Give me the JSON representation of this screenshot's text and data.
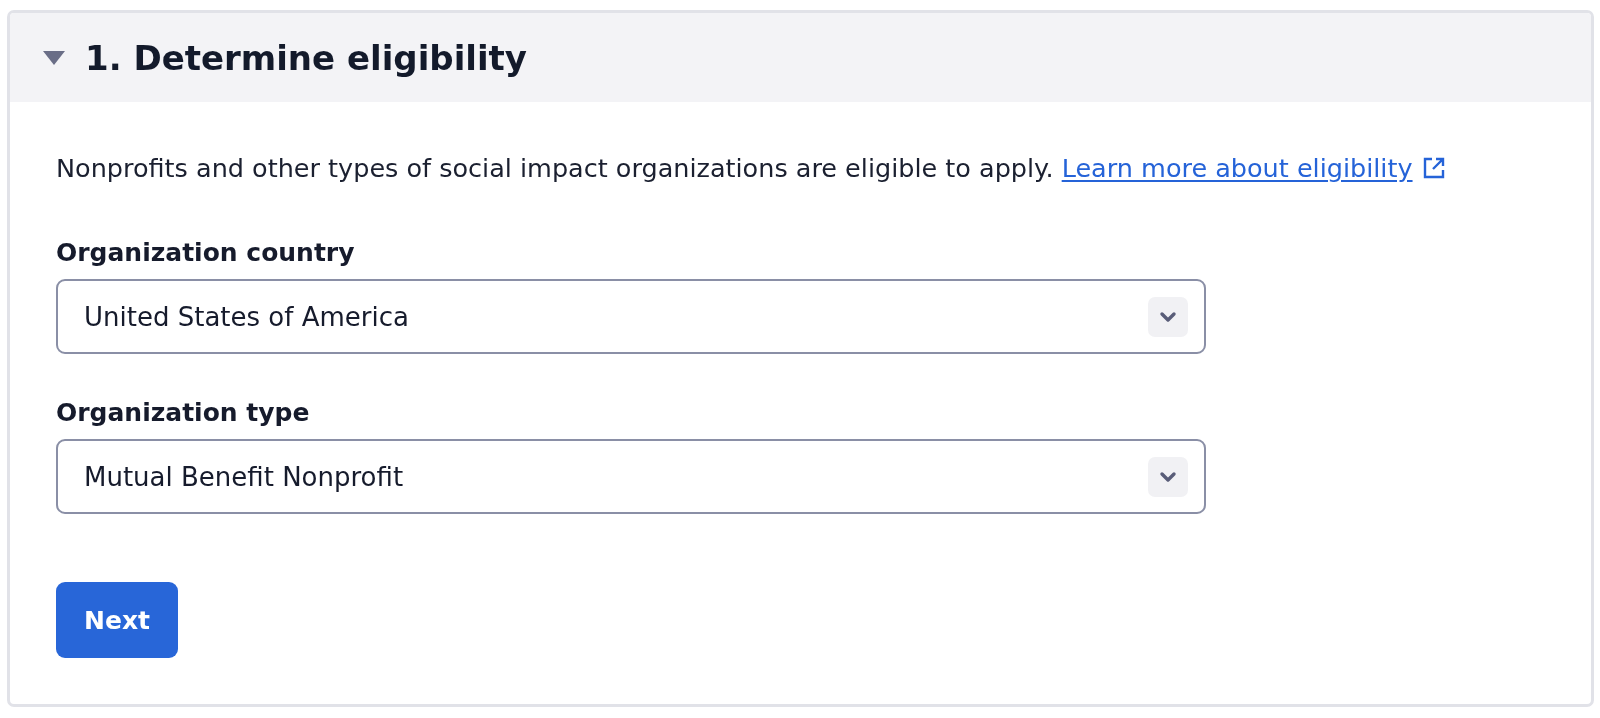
{
  "section": {
    "title": "1. Determine eligibility",
    "expanded": true
  },
  "intro": {
    "text": "Nonprofits and other types of social impact organizations are eligible to apply.",
    "link": "Learn more about eligibility"
  },
  "fields": [
    {
      "label": "Organization country",
      "value": "United States of America"
    },
    {
      "label": "Organization type",
      "value": "Mutual Benefit Nonprofit"
    }
  ],
  "buttons": [
    {
      "label": "Next",
      "kind": "primary"
    }
  ]
}
